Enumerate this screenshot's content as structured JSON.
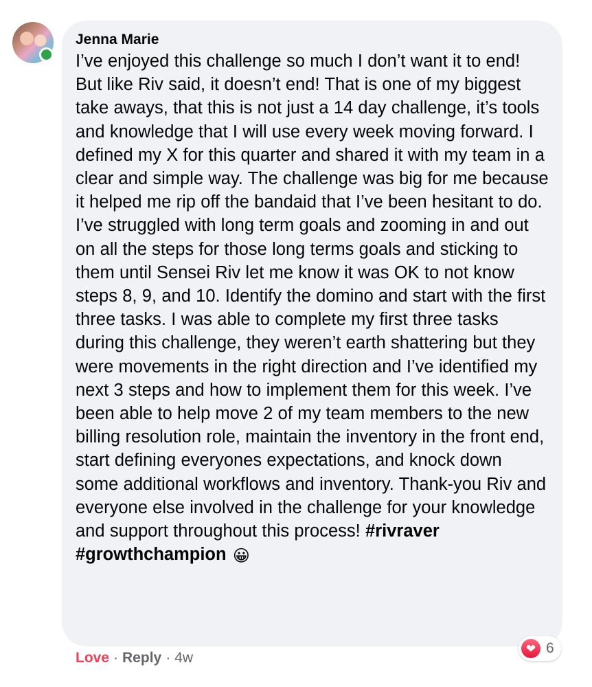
{
  "comment": {
    "author": "Jenna Marie",
    "text": "I’ve enjoyed this challenge so much I don’t want it to end! But like Riv said, it doesn’t end! That is one of my biggest take aways, that this is not just a 14 day challenge, it’s tools and knowledge that I will use every week moving forward. I defined my X for this quarter and shared it with my team in a clear and simple way. The challenge was big for me because it helped me rip off the bandaid that I’ve been hesitant to do. I’ve struggled with long term goals and zooming in and out on all the steps for those long terms goals and sticking to them until Sensei Riv let me know it was OK to not know steps 8, 9, and 10. Identify the domino and start with the first three tasks. I was able to complete my first three tasks during this challenge, they weren’t earth shattering but they were movements in the right direction and I’ve identified my next 3 steps and how to implement them for this week. I’ve been able to help move 2 of my team members to the new billing resolution role, maintain the inventory in the front end, start defining everyones expectations, and knock down some additional workflows and inventory. Thank-you Riv and everyone else involved in the challenge for your knowledge and support throughout this process!",
    "hashtags": [
      "#rivraver",
      "#growthchampion"
    ],
    "emoji": "😀",
    "online": true
  },
  "reactions": {
    "icon": "heart-icon",
    "icon_glyph": "❤",
    "count": "6",
    "color": "#f33e58"
  },
  "actions": {
    "love_label": "Love",
    "reply_label": "Reply",
    "separator": "·",
    "time": "4w"
  },
  "colors": {
    "bubble_bg": "#f0f2f5",
    "secondary_text": "#65676b",
    "online_green": "#31a24c"
  }
}
